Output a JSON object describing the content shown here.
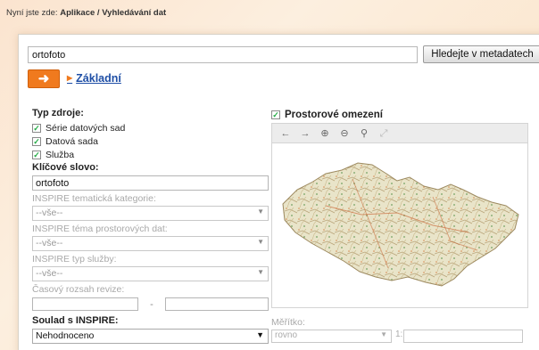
{
  "breadcrumb": {
    "prefix": "Nyní jste zde:",
    "path": "Aplikace / Vyhledávání dat"
  },
  "search": {
    "value": "ortofoto",
    "button_label": "Hledejte v metadatech"
  },
  "mode": {
    "arrow_icon": "arrow-right-icon",
    "link_label": "Základní"
  },
  "left": {
    "source_type_label": "Typ zdroje:",
    "source_types": [
      {
        "label": "Série datových sad",
        "checked": true
      },
      {
        "label": "Datová sada",
        "checked": true
      },
      {
        "label": "Služba",
        "checked": true
      }
    ],
    "keyword_label": "Klíčové slovo:",
    "keyword_value": "ortofoto",
    "inspire_category_label": "INSPIRE tematická kategorie:",
    "inspire_category_value": "--vše--",
    "inspire_theme_label": "INSPIRE téma prostorových dat:",
    "inspire_theme_value": "--vše--",
    "inspire_service_label": "INSPIRE typ služby:",
    "inspire_service_value": "--vše--",
    "time_range_label": "Časový rozsah revize:",
    "time_range_sep": "-",
    "compliance_label": "Soulad s INSPIRE:",
    "compliance_value": "Nehodnoceno"
  },
  "right": {
    "spatial_label": "Prostorové omezení",
    "spatial_checked": true,
    "scale_label": "Měřítko:",
    "scale_select_value": "rovno",
    "scale_ratio": "1:"
  },
  "colors": {
    "accent_orange": "#f07a1e",
    "link_blue": "#1f4fa6"
  }
}
